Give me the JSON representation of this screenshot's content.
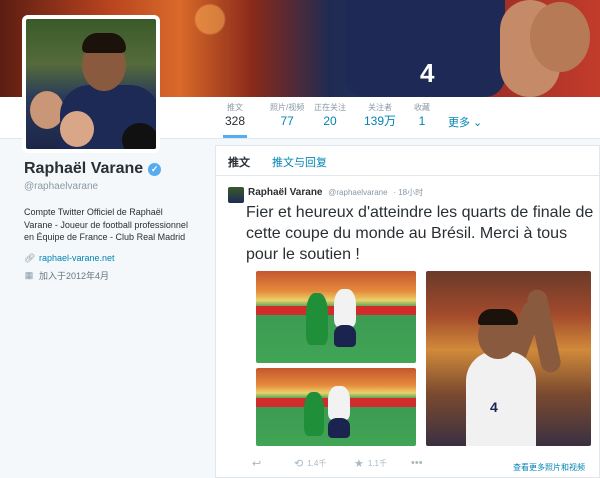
{
  "profile": {
    "name": "Raphaël Varane",
    "handle": "@raphaelvarane",
    "bio": "Compte Twitter Officiel de Raphaël Varane - Joueur de football professionnel en Équipe de France - Club Real Madrid",
    "website": "raphael-varane.net",
    "joined": "加入于2012年4月",
    "verified_icon": "check"
  },
  "banner": {
    "jersey_number": "4"
  },
  "stats": [
    {
      "label": "推文",
      "value": "328"
    },
    {
      "label": "照片/视频",
      "value": "77"
    },
    {
      "label": "正在关注",
      "value": "20"
    },
    {
      "label": "关注者",
      "value": "139万"
    },
    {
      "label": "收藏",
      "value": "1"
    }
  ],
  "more_label": "更多 ⌄",
  "tabs": {
    "tweets": "推文",
    "tweets_replies": "推文与回复"
  },
  "tweet": {
    "author": "Raphaël Varane",
    "handle": "@raphaelvarane",
    "time": "· 18小时",
    "text": "Fier et heureux d'atteindre les quarts de finale de cette coupe du monde au Brésil. Merci à tous pour le soutien !",
    "photo_jersey_number": "4",
    "retweets": "1.4千",
    "favorites": "1.1千",
    "view_more": "查看更多照片和视频"
  },
  "colors": {
    "accent": "#55acee",
    "link": "#0084b4"
  }
}
